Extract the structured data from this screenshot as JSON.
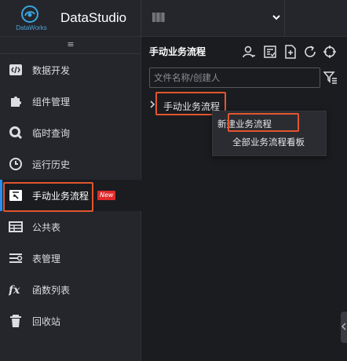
{
  "header": {
    "app_title": "DataStudio",
    "logo_sub": "DataWorks",
    "logo_icon": "dataworks-logo-icon",
    "workspace_icon": "chevron-down-icon"
  },
  "nav": {
    "collapse_glyph": "≡",
    "items": [
      {
        "label": "数据开发",
        "icon": "code-icon"
      },
      {
        "label": "组件管理",
        "icon": "puzzle-icon"
      },
      {
        "label": "临时查询",
        "icon": "search-icon"
      },
      {
        "label": "运行历史",
        "icon": "clock-icon"
      },
      {
        "label": "手动业务流程",
        "icon": "manual-flow-icon",
        "active": true,
        "badge": "New"
      },
      {
        "label": "公共表",
        "icon": "table-icon"
      },
      {
        "label": "表管理",
        "icon": "table-manage-icon"
      },
      {
        "label": "函数列表",
        "icon": "fx-icon"
      },
      {
        "label": "回收站",
        "icon": "trash-icon"
      }
    ]
  },
  "panel": {
    "title": "手动业务流程",
    "tools": [
      "person-icon",
      "list-check-icon",
      "new-file-icon",
      "refresh-icon",
      "locate-icon"
    ],
    "search_placeholder": "文件名称/创建人",
    "filter_icon": "filter-icon",
    "tree": [
      {
        "label": "手动业务流程",
        "expanded": false
      }
    ]
  },
  "context_menu": {
    "items": [
      "新建业务流程",
      "全部业务流程看板"
    ]
  },
  "colors": {
    "accent": "#2a8df1",
    "highlight": "#e2562e",
    "badge": "#e02a2a",
    "bg": "#1b1c20",
    "nav_bg": "#24262c"
  }
}
